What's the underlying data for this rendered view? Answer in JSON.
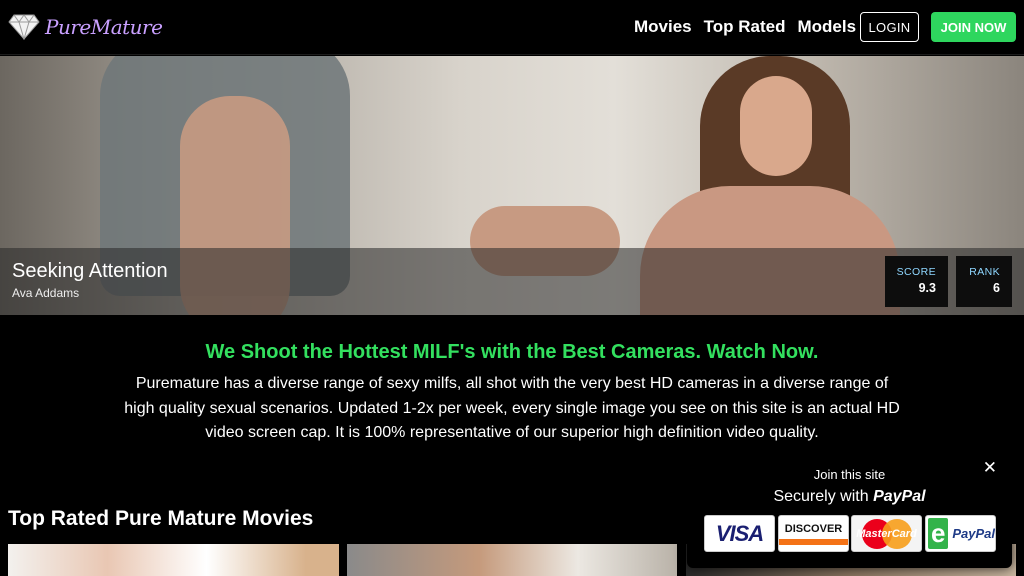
{
  "header": {
    "logo_text": "PureMature",
    "nav": [
      "Movies",
      "Top Rated",
      "Models"
    ],
    "login_label": "LOGIN",
    "join_label": "JOIN NOW"
  },
  "hero": {
    "title": "Seeking Attention",
    "model": "Ava Addams",
    "score_label": "SCORE",
    "score_value": "9.3",
    "rank_label": "RANK",
    "rank_value": "6"
  },
  "intro": {
    "heading": "We Shoot the Hottest MILF's with the Best Cameras. Watch Now.",
    "body": "Puremature has a diverse range of sexy milfs, all shot with the very best HD cameras in a diverse range of high quality sexual scenarios. Updated 1-2x per week, every single image you see on this site is an actual HD video screen cap. It is 100% representative of our superior high definition video quality."
  },
  "section": {
    "title": "Top Rated Pure Mature Movies"
  },
  "popup": {
    "small": "Join this site",
    "big_prefix": "Securely with",
    "big_brand": "PayPal",
    "close_glyph": "✕",
    "cards": [
      "VISA",
      "DISCOVER",
      "MasterCard",
      "PayPal"
    ]
  },
  "colors": {
    "accent_green": "#2ed65e",
    "heading_green": "#33e05f",
    "logo_purple": "#c9a0ff"
  }
}
